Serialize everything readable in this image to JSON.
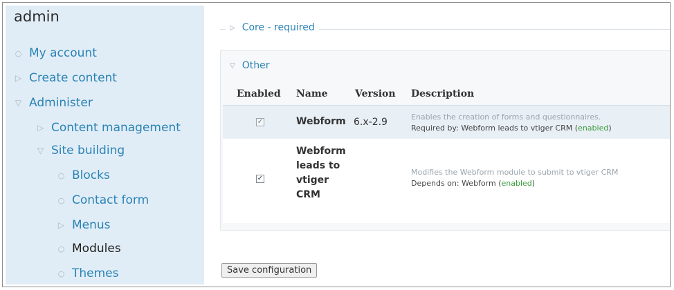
{
  "sidebar": {
    "title": "admin",
    "items": [
      {
        "label": "My account",
        "icon": "bullet"
      },
      {
        "label": "Create content",
        "icon": "arrow-right"
      },
      {
        "label": "Administer",
        "icon": "arrow-down"
      },
      {
        "label": "Content management",
        "icon": "arrow-right"
      },
      {
        "label": "Site building",
        "icon": "arrow-down"
      },
      {
        "label": "Blocks",
        "icon": "bullet"
      },
      {
        "label": "Contact form",
        "icon": "bullet"
      },
      {
        "label": "Menus",
        "icon": "arrow-right"
      },
      {
        "label": "Modules",
        "icon": "bullet",
        "active": true
      },
      {
        "label": "Themes",
        "icon": "bullet"
      }
    ]
  },
  "fieldsets": {
    "core": {
      "label": "Core - required",
      "collapsed": true
    },
    "other": {
      "label": "Other",
      "collapsed": false
    }
  },
  "table": {
    "headers": {
      "enabled": "Enabled",
      "name": "Name",
      "version": "Version",
      "description": "Description"
    },
    "rows": [
      {
        "enabled": true,
        "disabled": true,
        "name": "Webform",
        "version": "6.x-2.9",
        "description": "Enables the creation of forms and questionnaires.",
        "dependency_prefix": "Required by: Webform leads to vtiger CRM (",
        "dependency_status": "enabled",
        "dependency_suffix": ")"
      },
      {
        "enabled": true,
        "disabled": false,
        "name_lines": [
          "Webform",
          "leads to",
          "vtiger",
          "CRM"
        ],
        "version": "",
        "description": "Modifies the Webform module to submit to vtiger CRM",
        "dependency_prefix": "Depends on: Webform (",
        "dependency_status": "enabled",
        "dependency_suffix": ")"
      }
    ]
  },
  "save_button": "Save configuration",
  "colors": {
    "link": "#2a83b5",
    "sidebar_bg": "#e1edf6",
    "enabled_green": "#3c9b3c"
  }
}
